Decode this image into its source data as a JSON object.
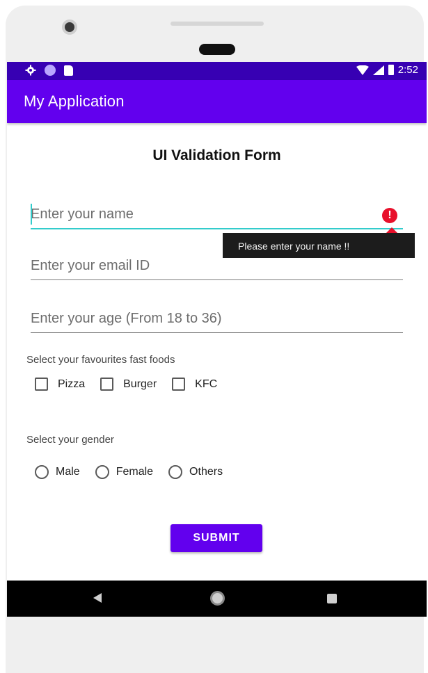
{
  "status_bar": {
    "time": "2:52",
    "icons": [
      "gear-icon",
      "circle-icon",
      "sd-card-icon",
      "wifi-icon",
      "signal-icon",
      "battery-icon"
    ]
  },
  "app_bar": {
    "title": "My Application"
  },
  "form": {
    "title": "UI Validation Form",
    "name_field": {
      "placeholder": "Enter your name",
      "value": ""
    },
    "name_error": "Please enter your name !!",
    "email_field": {
      "placeholder": "Enter your email ID",
      "value": ""
    },
    "age_field": {
      "placeholder": "Enter your age (From 18 to 36)",
      "value": ""
    },
    "foods_label": "Select your favourites fast foods",
    "foods": [
      {
        "label": "Pizza",
        "checked": false
      },
      {
        "label": "Burger",
        "checked": false
      },
      {
        "label": "KFC",
        "checked": false
      }
    ],
    "gender_label": "Select your gender",
    "genders": [
      {
        "label": "Male",
        "selected": false
      },
      {
        "label": "Female",
        "selected": false
      },
      {
        "label": "Others",
        "selected": false
      }
    ],
    "submit_label": "SUBMIT"
  },
  "colors": {
    "status_bar": "#3700b3",
    "primary": "#6200ee",
    "focus_accent": "#33cccc",
    "error": "#e8102b"
  },
  "nav_bar": {
    "icons": [
      "back-icon",
      "home-icon",
      "recent-apps-icon"
    ]
  }
}
